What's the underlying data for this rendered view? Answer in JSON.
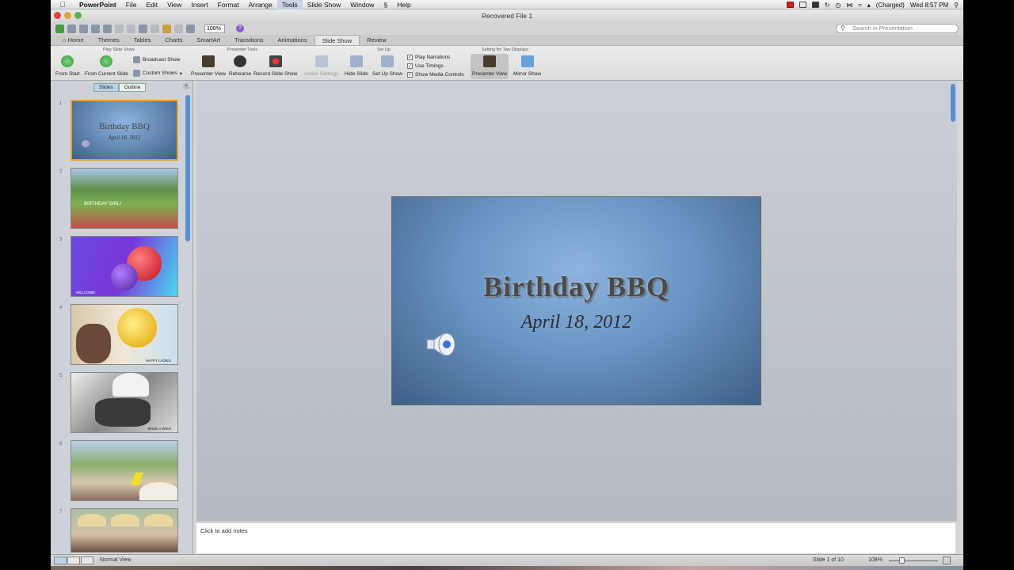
{
  "menubar": {
    "app": "PowerPoint",
    "items": [
      "File",
      "Edit",
      "View",
      "Insert",
      "Format",
      "Arrange",
      "Tools",
      "Slide Show",
      "Window",
      "Help"
    ],
    "battery": "(Charged)",
    "clock": "Wed 8:57 PM"
  },
  "window": {
    "title": "Recovered File 1"
  },
  "toolbar": {
    "zoom": "108%",
    "search_placeholder": "Search in Presentation"
  },
  "ribbon_tabs": [
    "Home",
    "Themes",
    "Tables",
    "Charts",
    "SmartArt",
    "Transitions",
    "Animations",
    "Slide Show",
    "Review"
  ],
  "ribbon": {
    "groups": [
      "Play Slide Show",
      "Presenter Tools",
      "Set Up",
      "Setting for Two Displays"
    ],
    "buttons": {
      "from_start": "From Start",
      "from_current": "From Current Slide",
      "broadcast": "Broadcast Show",
      "custom_shows": "Custom Shows",
      "presenter_view": "Presenter View",
      "rehearse": "Rehearse",
      "record": "Record Slide Show",
      "action_settings": "Action Settings",
      "hide_slide": "Hide Slide",
      "set_up_show": "Set Up Show",
      "play_narrations": "Play Narrations",
      "use_timings": "Use Timings",
      "show_media": "Show Media Controls",
      "presenter_view_2": "Presenter View",
      "mirror_show": "Mirror Show"
    }
  },
  "panel": {
    "tabs": [
      "Slides",
      "Outline"
    ],
    "thumb2_text": "BIRTHDAY GIRL!",
    "thumb3_text": "WELCOME!",
    "thumb4_text": "HAPPY LADIES",
    "thumb5_text": "MAKE A WISH",
    "thumb1_title": "Birthday BBQ",
    "thumb1_sub": "April 18, 2012",
    "nums": [
      "1",
      "2",
      "3",
      "4",
      "5",
      "6",
      "7"
    ]
  },
  "slide": {
    "title": "Birthday BBQ",
    "subtitle": "April 18, 2012"
  },
  "notes": {
    "placeholder": "Click to add notes"
  },
  "status": {
    "view": "Normal View",
    "slide_pos": "Slide 1 of 10",
    "zoom": "108%"
  },
  "colors": {
    "slide_bg": "#6a94c4",
    "selection": "#f0a030",
    "accent": "#5a8fd6"
  }
}
